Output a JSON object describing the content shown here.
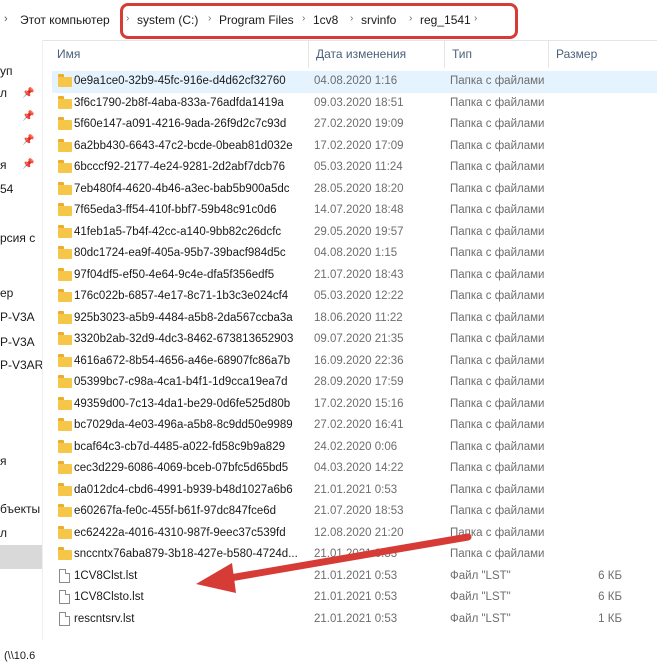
{
  "address_bar": {
    "crumbs": [
      "Этот компьютер",
      "system (C:)",
      "Program Files",
      "1cv8",
      "srvinfo",
      "reg_1541"
    ],
    "separator": "›",
    "highlight_color": "#d63b35"
  },
  "nav_pane": {
    "items": [
      "уп",
      "л",
      "",
      "",
      "я",
      "54",
      "",
      "",
      "рсия с",
      "",
      "",
      "ер",
      "P-V3A",
      "P-V3A",
      "P-V3AR",
      "",
      "",
      "",
      "",
      "",
      "я",
      "",
      "бъекты",
      "л",
      "",
      ""
    ],
    "pin_icon": "pin-icon"
  },
  "columns": {
    "name": "Имя",
    "date": "Дата изменения",
    "type": "Тип",
    "size": "Размер"
  },
  "files": [
    {
      "name": "0e9a1ce0-32b9-45fc-916e-d4d62cf32760",
      "date": "04.08.2020 1:16",
      "type": "Папка с файлами",
      "size": "",
      "kind": "folder"
    },
    {
      "name": "3f6c1790-2b8f-4aba-833a-76adfda1419a",
      "date": "09.03.2020 18:51",
      "type": "Папка с файлами",
      "size": "",
      "kind": "folder"
    },
    {
      "name": "5f60e147-a091-4216-9ada-26f9d2c7c93d",
      "date": "27.02.2020 19:09",
      "type": "Папка с файлами",
      "size": "",
      "kind": "folder"
    },
    {
      "name": "6a2bb430-6643-47c2-bcde-0beab81d032e",
      "date": "17.02.2020 17:09",
      "type": "Папка с файлами",
      "size": "",
      "kind": "folder"
    },
    {
      "name": "6bcccf92-2177-4e24-9281-2d2abf7dcb76",
      "date": "05.03.2020 11:24",
      "type": "Папка с файлами",
      "size": "",
      "kind": "folder"
    },
    {
      "name": "7eb480f4-4620-4b46-a3ec-bab5b900a5dc",
      "date": "28.05.2020 18:20",
      "type": "Папка с файлами",
      "size": "",
      "kind": "folder"
    },
    {
      "name": "7f65eda3-ff54-410f-bbf7-59b48c91c0d6",
      "date": "14.07.2020 18:48",
      "type": "Папка с файлами",
      "size": "",
      "kind": "folder"
    },
    {
      "name": "41feb1a5-7b4f-42cc-a140-9bb82c26dcfc",
      "date": "29.05.2020 19:57",
      "type": "Папка с файлами",
      "size": "",
      "kind": "folder"
    },
    {
      "name": "80dc1724-ea9f-405a-95b7-39bacf984d5c",
      "date": "04.08.2020 1:15",
      "type": "Папка с файлами",
      "size": "",
      "kind": "folder"
    },
    {
      "name": "97f04df5-ef50-4e64-9c4e-dfa5f356edf5",
      "date": "21.07.2020 18:43",
      "type": "Папка с файлами",
      "size": "",
      "kind": "folder"
    },
    {
      "name": "176c022b-6857-4e17-8c71-1b3c3e024cf4",
      "date": "05.03.2020 12:22",
      "type": "Папка с файлами",
      "size": "",
      "kind": "folder"
    },
    {
      "name": "925b3023-a5b9-4484-a5b8-2da567ccba3a",
      "date": "18.06.2020 11:22",
      "type": "Папка с файлами",
      "size": "",
      "kind": "folder"
    },
    {
      "name": "3320b2ab-32d9-4dc3-8462-673813652903",
      "date": "09.07.2020 21:35",
      "type": "Папка с файлами",
      "size": "",
      "kind": "folder"
    },
    {
      "name": "4616a672-8b54-4656-a46e-68907fc86a7b",
      "date": "16.09.2020 22:36",
      "type": "Папка с файлами",
      "size": "",
      "kind": "folder"
    },
    {
      "name": "05399bc7-c98a-4ca1-b4f1-1d9cca19ea7d",
      "date": "28.09.2020 17:59",
      "type": "Папка с файлами",
      "size": "",
      "kind": "folder"
    },
    {
      "name": "49359d00-7c13-4da1-be29-0d6fe525d80b",
      "date": "17.02.2020 15:16",
      "type": "Папка с файлами",
      "size": "",
      "kind": "folder"
    },
    {
      "name": "bc7029da-4e03-496a-a5b8-8c9dd50e9989",
      "date": "27.02.2020 16:41",
      "type": "Папка с файлами",
      "size": "",
      "kind": "folder"
    },
    {
      "name": "bcaf64c3-cb7d-4485-a022-fd58c9b9a829",
      "date": "24.02.2020 0:06",
      "type": "Папка с файлами",
      "size": "",
      "kind": "folder"
    },
    {
      "name": "cec3d229-6086-4069-bceb-07bfc5d65bd5",
      "date": "04.03.2020 14:22",
      "type": "Папка с файлами",
      "size": "",
      "kind": "folder"
    },
    {
      "name": "da012dc4-cbd6-4991-b939-b48d1027a6b6",
      "date": "21.01.2021 0:53",
      "type": "Папка с файлами",
      "size": "",
      "kind": "folder"
    },
    {
      "name": "e60267fa-fe0c-455f-b61f-97dc847fce6d",
      "date": "21.07.2020 18:53",
      "type": "Папка с файлами",
      "size": "",
      "kind": "folder"
    },
    {
      "name": "ec62422a-4016-4310-987f-9eec37c539fd",
      "date": "12.08.2020 21:20",
      "type": "Папка с файлами",
      "size": "",
      "kind": "folder"
    },
    {
      "name": "snccntx76aba879-3b18-427e-b580-4724d...",
      "date": "21.01.2021 0:53",
      "type": "Папка с файлами",
      "size": "",
      "kind": "folder"
    },
    {
      "name": "1CV8Clst.lst",
      "date": "21.01.2021 0:53",
      "type": "Файл \"LST\"",
      "size": "6 КБ",
      "kind": "file"
    },
    {
      "name": "1CV8Clsto.lst",
      "date": "21.01.2021 0:53",
      "type": "Файл \"LST\"",
      "size": "6 КБ",
      "kind": "file"
    },
    {
      "name": "rescntsrv.lst",
      "date": "21.01.2021 0:53",
      "type": "Файл \"LST\"",
      "size": "1 КБ",
      "kind": "file"
    }
  ],
  "status_bar": {
    "text": "(\\\\10.6"
  },
  "annotation": {
    "arrow_color": "#d63b35",
    "icon": "red-arrow-icon"
  }
}
